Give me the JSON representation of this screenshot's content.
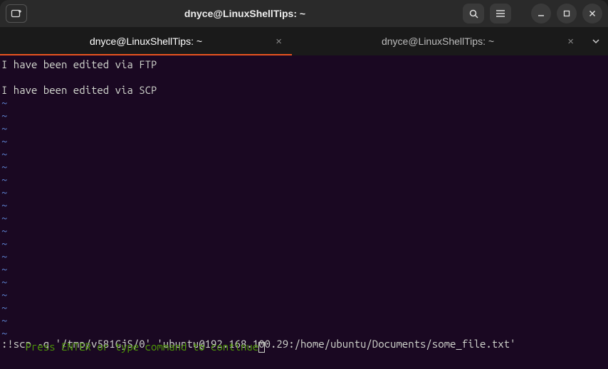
{
  "window": {
    "title": "dnyce@LinuxShellTips: ~"
  },
  "tabs": [
    {
      "label": "dnyce@LinuxShellTips: ~",
      "active": true
    },
    {
      "label": "dnyce@LinuxShellTips: ~",
      "active": false
    }
  ],
  "editor": {
    "lines": [
      "I have been edited via FTP",
      "",
      "I have been edited via SCP"
    ],
    "tilde_count": 19,
    "command_line": ":!scp -q '/tmp/v581GjS/0' 'ubuntu@192.168.100.29:/home/ubuntu/Documents/some_file.txt'",
    "status_line": "Press ENTER or type command to continue"
  },
  "colors": {
    "accent": "#e95420",
    "tilde": "#5f87d7",
    "status": "#4e9a06",
    "text": "#d3d7cf",
    "terminal_bg": "#1a0822"
  }
}
